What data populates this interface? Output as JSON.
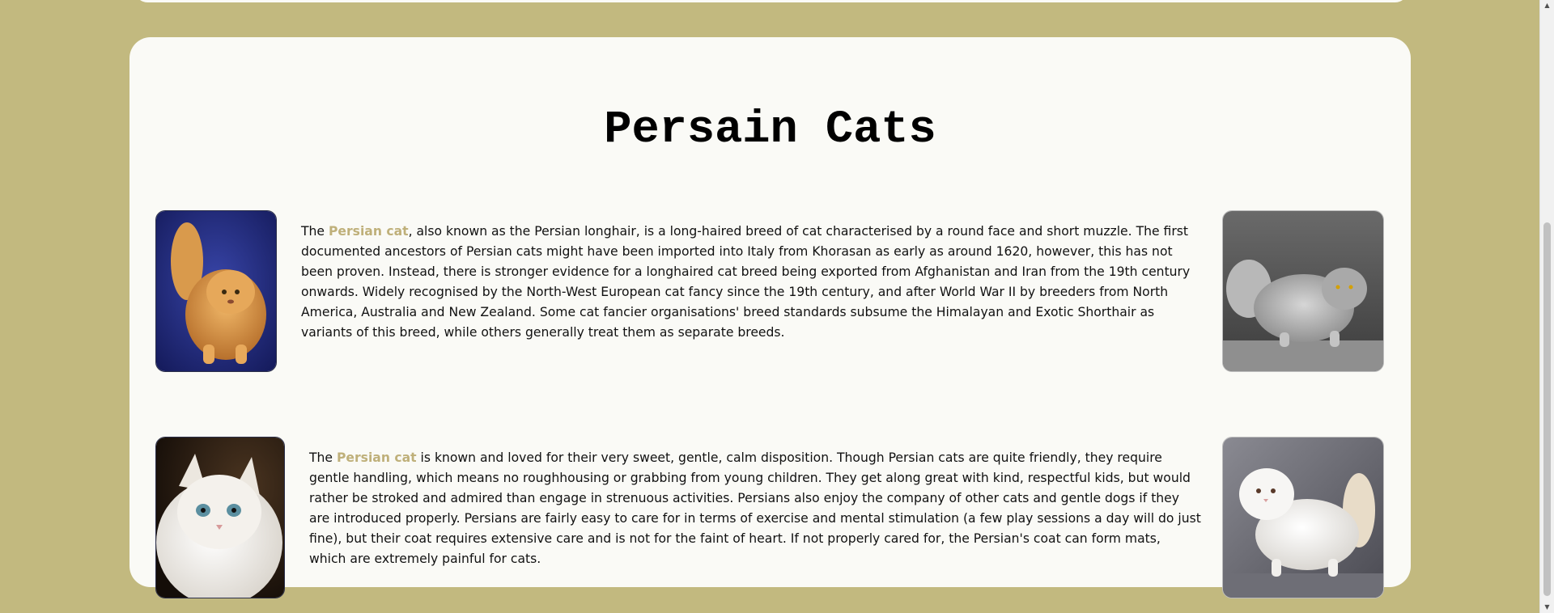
{
  "page": {
    "title": "Persain Cats"
  },
  "sections": [
    {
      "para_prefix": "The ",
      "highlight": "Persian cat",
      "para_rest": ", also known as the Persian longhair, is a long-haired breed of cat characterised by a round face and short muzzle. The first documented ancestors of Persian cats might have been imported into Italy from Khorasan as early as around 1620, however, this has not been proven. Instead, there is stronger evidence for a longhaired cat breed being exported from Afghanistan and Iran from the 19th century onwards. Widely recognised by the North-West European cat fancy since the 19th century, and after World War II by breeders from North America, Australia and New Zealand. Some cat fancier organisations' breed standards subsume the Himalayan and Exotic Shorthair as variants of this breed, while others generally treat them as separate breeds."
    },
    {
      "para_prefix": "The ",
      "highlight": "Persian cat",
      "para_rest": " is known and loved for their very sweet, gentle, calm disposition. Though Persian cats are quite friendly, they require gentle handling, which means no roughhousing or grabbing from young children. They get along great with kind, respectful kids, but would rather be stroked and admired than engage in strenuous activities. Persians also enjoy the company of other cats and gentle dogs if they are introduced properly. Persians are fairly easy to care for in terms of exercise and mental stimulation (a few play sessions a day will do just fine), but their coat requires extensive care and is not for the faint of heart. If not properly cared for, the Persian's coat can form mats, which are extremely painful for cats."
    }
  ],
  "colors": {
    "background": "#c2b97f",
    "card": "#fafaf6",
    "highlight": "#bfb07a"
  },
  "icons": {
    "scroll_up": "triangle-up",
    "scroll_down": "triangle-down"
  }
}
